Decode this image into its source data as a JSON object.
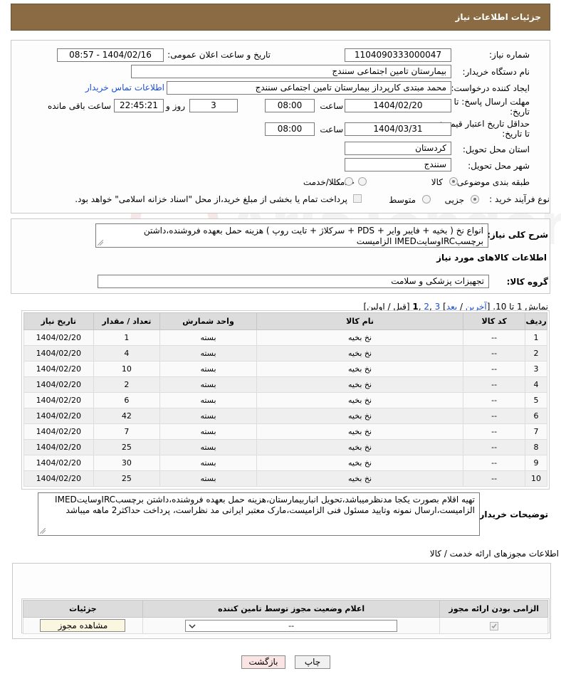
{
  "header": {
    "title": "جزئیات اطلاعات نیاز"
  },
  "fields": {
    "need_number": {
      "label": "شماره نیاز:",
      "value": "1104090333000047"
    },
    "announce": {
      "label": "تاریخ و ساعت اعلان عمومی:",
      "value": "1404/02/16 - 08:57"
    },
    "buyer_org": {
      "label": "نام دستگاه خریدار:",
      "value": "بیمارستان تامین اجتماعی سنندج"
    },
    "creator": {
      "label": "ایجاد کننده درخواست:",
      "value": "محمد مبتدی کارپرداز بیمارستان تامین اجتماعی سنندج",
      "contact_link": "اطلاعات تماس خریدار"
    },
    "deadline": {
      "label_line1": "مهلت ارسال پاسخ: تا",
      "label_line2": "تاریخ:",
      "date": "1404/02/20",
      "time_label": "ساعت",
      "time": "08:00",
      "days": "3",
      "days_label": "روز و",
      "remaining": "22:45:21",
      "remaining_label": "ساعت باقی مانده"
    },
    "price_validity": {
      "label_line1": "حداقل تاریخ اعتبار قیمت:",
      "label_line2": "تا تاریخ:",
      "date": "1404/03/31",
      "time_label": "ساعت",
      "time": "08:00"
    },
    "province": {
      "label": "استان محل تحویل:",
      "value": "کردستان"
    },
    "city": {
      "label": "شهر محل تحویل:",
      "value": "سنندج"
    },
    "category": {
      "label": "طبقه بندی موضوعی:",
      "options": [
        "کالا",
        "خدمت",
        "کالا/خدمت"
      ]
    },
    "process": {
      "label": "نوع فرآیند خرید :",
      "options": [
        "جزیی",
        "متوسط"
      ],
      "note": "پرداخت تمام یا بخشی از مبلغ خرید،از محل \"اسناد خزانه اسلامی\" خواهد بود."
    }
  },
  "general_desc": {
    "label": "شرح کلی نیاز:",
    "line1": "انواع نخ ( بخیه + فایبر وایر + PDS + سرکلاژ + تایت روپ ) هزینه حمل بعهده فروشنده،داشتن",
    "line2": "برچسبIRCوسایتIMED الزامیست"
  },
  "goods_info": {
    "title": "اطلاعات کالاهای مورد نیاز",
    "group_label": "گروه کالا:",
    "group_value": "تجهیزات پزشکی و سلامت"
  },
  "pagination": {
    "prefix": "نمایش 1 تا 10. [",
    "last": "آخرین",
    "sep1": " / ",
    "next": "بعد",
    "sep2": "] ",
    "p3": "3",
    "c1": " ,",
    "p2": "2",
    "c2": " ,",
    "p1": "1",
    "suffix": " [قبل / اولین]"
  },
  "table": {
    "headers": [
      "ردیف",
      "کد کالا",
      "نام کالا",
      "واحد شمارش",
      "تعداد / مقدار",
      "تاریخ نیاز"
    ],
    "rows": [
      [
        "1",
        "--",
        "نخ بخیه",
        "بسته",
        "1",
        "1404/02/20"
      ],
      [
        "2",
        "--",
        "نخ بخیه",
        "بسته",
        "4",
        "1404/02/20"
      ],
      [
        "3",
        "--",
        "نخ بخیه",
        "بسته",
        "10",
        "1404/02/20"
      ],
      [
        "4",
        "--",
        "نخ بخیه",
        "بسته",
        "2",
        "1404/02/20"
      ],
      [
        "5",
        "--",
        "نخ بخیه",
        "بسته",
        "6",
        "1404/02/20"
      ],
      [
        "6",
        "--",
        "نخ بخیه",
        "بسته",
        "42",
        "1404/02/20"
      ],
      [
        "7",
        "--",
        "نخ بخیه",
        "بسته",
        "7",
        "1404/02/20"
      ],
      [
        "8",
        "--",
        "نخ بخیه",
        "بسته",
        "25",
        "1404/02/20"
      ],
      [
        "9",
        "--",
        "نخ بخیه",
        "بسته",
        "30",
        "1404/02/20"
      ],
      [
        "10",
        "--",
        "نخ بخیه",
        "بسته",
        "25",
        "1404/02/20"
      ]
    ]
  },
  "buyer_notes": {
    "label": "توضیحات خریدار:",
    "line1": "تهیه اقلام بصورت یکجا مدنظرمیباشد،تحویل انباربیمارستان،هزینه حمل بعهده فروشنده،داشتن برچسبIRCوسایتIMED",
    "line2": "الزامیست،ارسال نمونه وتایید مسئول فنی الزامیست،مارک معتبر ایرانی مد نظراست، پرداخت حداکثر2 ماهه میباشد"
  },
  "permits": {
    "title": "اطلاعات مجوزهای ارائه خدمت / کالا",
    "headers": [
      "الزامی بودن ارائه مجوز",
      "اعلام وضعیت مجوز توسط تامین کننده",
      "جزئیات"
    ],
    "select_value": "--",
    "view_button": "مشاهده مجوز"
  },
  "buttons": {
    "print": "چاپ",
    "back": "بازگشت"
  },
  "watermark": "AriaTender.neT"
}
